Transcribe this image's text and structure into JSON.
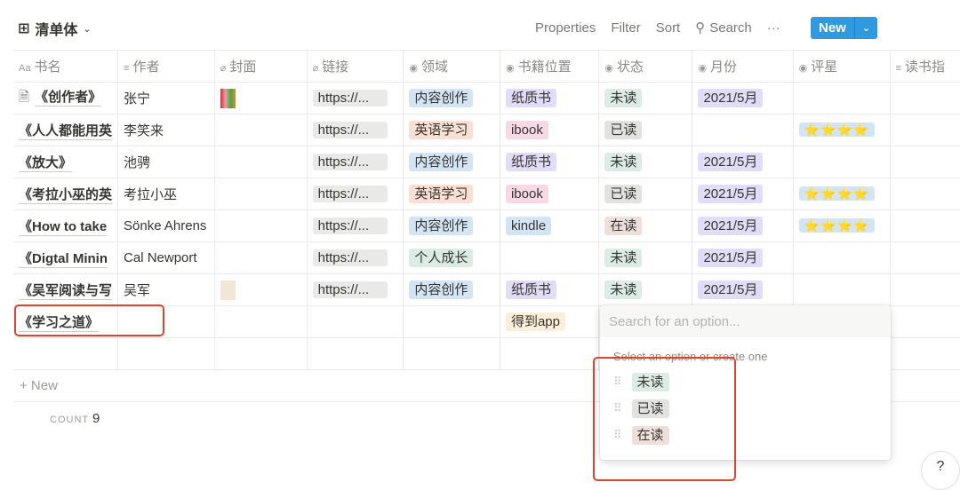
{
  "view": {
    "title": "清单体",
    "icon": "table-icon"
  },
  "toolbar": {
    "properties": "Properties",
    "filter": "Filter",
    "sort": "Sort",
    "search": "Search",
    "more": "···",
    "new": "New"
  },
  "columns": [
    {
      "label": "书名",
      "icon": "Aa"
    },
    {
      "label": "作者",
      "icon": "≡"
    },
    {
      "label": "封面",
      "icon": "⌀"
    },
    {
      "label": "链接",
      "icon": "⌀"
    },
    {
      "label": "领域",
      "icon": "◉"
    },
    {
      "label": "书籍位置",
      "icon": "◉"
    },
    {
      "label": "状态",
      "icon": "◉"
    },
    {
      "label": "月份",
      "icon": "◉"
    },
    {
      "label": "评星",
      "icon": "◉"
    },
    {
      "label": "读书指",
      "icon": "≡"
    }
  ],
  "rows": [
    {
      "name": "《创作者》",
      "author": "张宁",
      "cover": true,
      "link": "https://...",
      "field": "内容创作",
      "location": "纸质书",
      "status": "未读",
      "month": "2021/5月",
      "stars": ""
    },
    {
      "name": "《人人都能用英",
      "author": "李笑来",
      "cover": false,
      "link": "https://...",
      "field": "英语学习",
      "location": "ibook",
      "status": "已读",
      "month": "",
      "stars": "⭐⭐⭐⭐"
    },
    {
      "name": "《放大》",
      "author": "池骋",
      "cover": false,
      "link": "https://...",
      "field": "内容创作",
      "location": "纸质书",
      "status": "未读",
      "month": "2021/5月",
      "stars": ""
    },
    {
      "name": "《考拉小巫的英",
      "author": "考拉小巫",
      "cover": false,
      "link": "https://...",
      "field": "英语学习",
      "location": "ibook",
      "status": "已读",
      "month": "2021/5月",
      "stars": "⭐⭐⭐⭐"
    },
    {
      "name": "《How to take",
      "author": "Sönke Ahrens",
      "cover": false,
      "link": "https://...",
      "field": "内容创作",
      "location": "kindle",
      "status": "在读",
      "month": "2021/5月",
      "stars": "⭐⭐⭐⭐"
    },
    {
      "name": "《Digtal Minin",
      "author": "Cal Newport",
      "cover": false,
      "link": "https://...",
      "field": "个人成长",
      "location": "",
      "status": "未读",
      "month": "2021/5月",
      "stars": ""
    },
    {
      "name": "《吴军阅读与写",
      "author": "吴军",
      "cover": true,
      "link": "https://...",
      "field": "内容创作",
      "location": "纸质书",
      "status": "未读",
      "month": "2021/5月",
      "stars": ""
    },
    {
      "name": "《学习之道》",
      "author": "",
      "cover": false,
      "link": "",
      "field": "",
      "location": "得到app",
      "status": "",
      "month": "",
      "stars": ""
    }
  ],
  "footer": {
    "add_new": "+ New",
    "count_label": "COUNT",
    "count_value": "9"
  },
  "popup": {
    "placeholder": "Search for an option...",
    "hint": "Select an option or create one",
    "options": [
      "未读",
      "已读",
      "在读"
    ]
  },
  "colors": {
    "accent": "#2f9ae0",
    "highlight": "#e2412c"
  }
}
